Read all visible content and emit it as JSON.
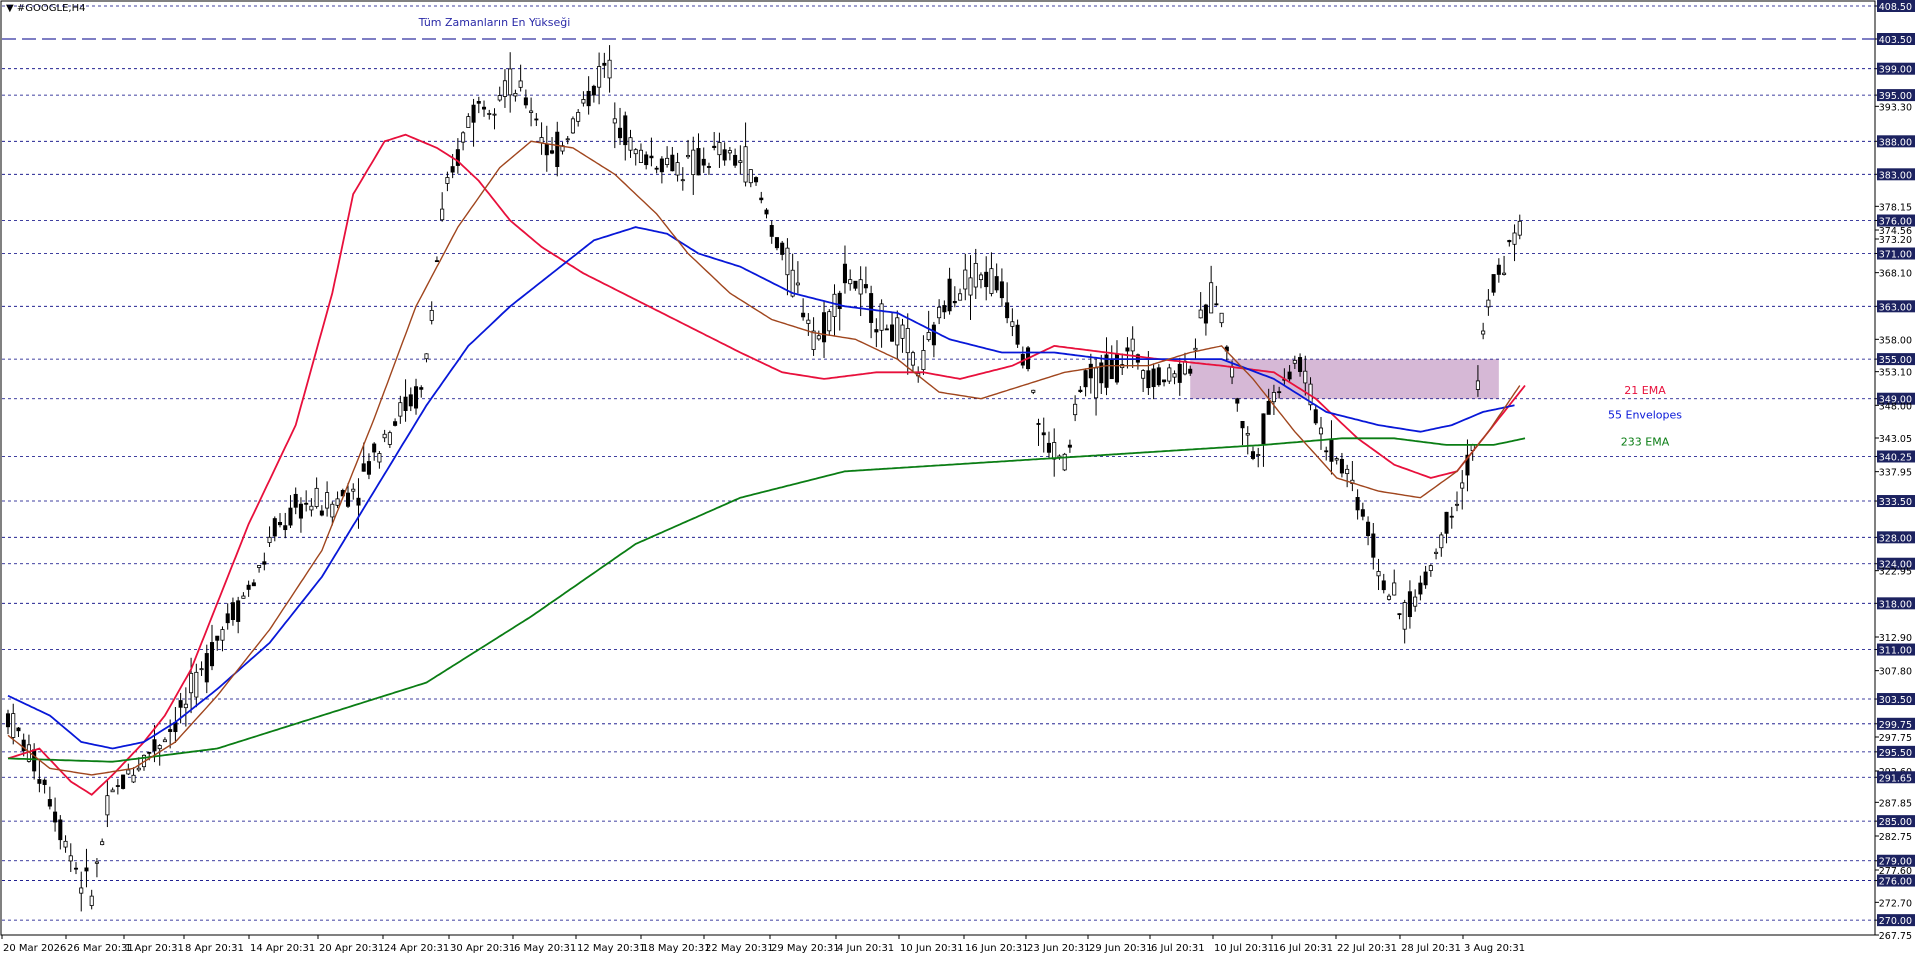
{
  "header": {
    "title": "#GOOGLE,H4"
  },
  "colors": {
    "background": "#ffffff",
    "grid": "#000080",
    "ema21": "#e8103c",
    "envelopes55": "#0818d8",
    "ema233": "#0a7d14",
    "ema_brown": "#a0461e",
    "zone": "#c8a0c8",
    "ath_line": "#3030a0",
    "axis_badge": "#1c2260"
  },
  "chart_data": {
    "type": "candlestick",
    "symbol": "#GOOGLE",
    "timeframe": "H4",
    "ylim": [
      267.75,
      408.5
    ],
    "horizontal_levels": [
      408.5,
      403.5,
      399.0,
      395.0,
      388.0,
      383.0,
      376.0,
      371.0,
      363.0,
      355.0,
      349.0,
      340.25,
      333.5,
      328.0,
      324.0,
      318.0,
      311.0,
      303.5,
      299.75,
      295.5,
      291.65,
      285.0,
      279.0,
      276.0,
      270.0
    ],
    "y_tick_labels": [
      "408.50",
      "403.50",
      "399.00",
      "395.00",
      "393.30",
      "388.00",
      "383.00",
      "378.15",
      "376.00",
      "374.56",
      "373.20",
      "371.00",
      "368.10",
      "363.00",
      "358.00",
      "355.00",
      "353.10",
      "349.00",
      "348.00",
      "343.05",
      "340.25",
      "337.95",
      "333.50",
      "328.00",
      "324.00",
      "322.95",
      "318.00",
      "312.90",
      "311.00",
      "307.80",
      "303.50",
      "299.75",
      "297.75",
      "295.50",
      "292.60",
      "291.65",
      "287.85",
      "285.00",
      "282.75",
      "279.00",
      "277.60",
      "276.00",
      "272.70",
      "270.00",
      "267.75"
    ],
    "x_tick_labels": [
      "20 Mar 2026",
      "26 Mar 20:31",
      "1 Apr 20:31",
      "8 Apr 20:31",
      "14 Apr 20:31",
      "20 Apr 20:31",
      "24 Apr 20:31",
      "30 Apr 20:31",
      "6 May 20:31",
      "12 May 20:31",
      "18 May 20:31",
      "22 May 20:31",
      "29 May 20:31",
      "4 Jun 20:31",
      "10 Jun 20:31",
      "16 Jun 20:31",
      "23 Jun 20:31",
      "29 Jun 20:31",
      "6 Jul 20:31",
      "10 Jul 20:31",
      "16 Jul 20:31",
      "22 Jul 20:31",
      "28 Jul 20:31",
      "3 Aug 20:31"
    ],
    "annotations": {
      "ath_label": "Tüm Zamanların En Yükseği",
      "ath_level": 403.5
    },
    "zone": {
      "from": 349.0,
      "to": 355.0
    },
    "legend": [
      "21 EMA",
      "55 Envelopes",
      "233 EMA"
    ],
    "series": [
      {
        "name": "21 EMA",
        "anchors": [
          [
            0,
            294.5
          ],
          [
            6,
            296
          ],
          [
            12,
            291
          ],
          [
            16,
            289
          ],
          [
            20,
            292
          ],
          [
            26,
            297
          ],
          [
            30,
            301
          ],
          [
            35,
            308
          ],
          [
            40,
            318
          ],
          [
            46,
            330
          ],
          [
            55,
            345
          ],
          [
            62,
            365
          ],
          [
            66,
            380
          ],
          [
            72,
            388
          ],
          [
            76,
            389
          ],
          [
            82,
            387
          ],
          [
            86,
            385
          ],
          [
            90,
            382
          ],
          [
            96,
            376
          ],
          [
            102,
            372
          ],
          [
            110,
            368
          ],
          [
            120,
            364
          ],
          [
            130,
            360
          ],
          [
            140,
            356
          ],
          [
            148,
            353
          ],
          [
            156,
            352
          ],
          [
            166,
            353
          ],
          [
            175,
            353
          ],
          [
            182,
            352
          ],
          [
            192,
            354
          ],
          [
            200,
            357
          ],
          [
            210,
            356
          ],
          [
            220,
            355
          ],
          [
            232,
            354
          ],
          [
            242,
            353
          ],
          [
            250,
            349
          ],
          [
            258,
            343
          ],
          [
            265,
            339
          ],
          [
            272,
            337
          ],
          [
            277,
            338
          ],
          [
            282,
            343
          ],
          [
            287,
            348
          ],
          [
            290,
            351
          ]
        ]
      },
      {
        "name": "55 Envelopes",
        "anchors": [
          [
            0,
            304
          ],
          [
            8,
            301
          ],
          [
            14,
            297
          ],
          [
            20,
            296
          ],
          [
            26,
            297
          ],
          [
            32,
            300
          ],
          [
            40,
            305
          ],
          [
            50,
            312
          ],
          [
            60,
            322
          ],
          [
            70,
            335
          ],
          [
            80,
            348
          ],
          [
            88,
            357
          ],
          [
            96,
            363
          ],
          [
            104,
            368
          ],
          [
            112,
            373
          ],
          [
            120,
            375
          ],
          [
            126,
            374
          ],
          [
            132,
            371
          ],
          [
            140,
            369
          ],
          [
            150,
            365
          ],
          [
            160,
            363
          ],
          [
            170,
            362
          ],
          [
            180,
            358
          ],
          [
            190,
            356
          ],
          [
            200,
            356
          ],
          [
            210,
            355
          ],
          [
            220,
            355
          ],
          [
            232,
            355
          ],
          [
            242,
            352
          ],
          [
            252,
            347
          ],
          [
            262,
            345
          ],
          [
            270,
            344
          ],
          [
            276,
            345
          ],
          [
            282,
            347
          ],
          [
            288,
            348
          ]
        ]
      },
      {
        "name": "233 EMA",
        "anchors": [
          [
            0,
            294.5
          ],
          [
            20,
            294
          ],
          [
            40,
            296
          ],
          [
            60,
            301
          ],
          [
            80,
            306
          ],
          [
            100,
            316
          ],
          [
            120,
            327
          ],
          [
            140,
            334
          ],
          [
            160,
            338
          ],
          [
            180,
            339
          ],
          [
            200,
            340
          ],
          [
            220,
            341
          ],
          [
            240,
            342
          ],
          [
            255,
            343
          ],
          [
            265,
            343
          ],
          [
            275,
            342
          ],
          [
            284,
            342
          ],
          [
            290,
            343
          ]
        ]
      },
      {
        "name": "brown",
        "anchors": [
          [
            0,
            298
          ],
          [
            8,
            293
          ],
          [
            16,
            292
          ],
          [
            24,
            293
          ],
          [
            32,
            297
          ],
          [
            40,
            304
          ],
          [
            50,
            314
          ],
          [
            60,
            326
          ],
          [
            70,
            346
          ],
          [
            78,
            363
          ],
          [
            86,
            375
          ],
          [
            94,
            384
          ],
          [
            100,
            388
          ],
          [
            108,
            387
          ],
          [
            116,
            383
          ],
          [
            124,
            377
          ],
          [
            130,
            371
          ],
          [
            138,
            365
          ],
          [
            146,
            361
          ],
          [
            154,
            359
          ],
          [
            162,
            358
          ],
          [
            170,
            355
          ],
          [
            178,
            350
          ],
          [
            186,
            349
          ],
          [
            194,
            351
          ],
          [
            202,
            353
          ],
          [
            210,
            354
          ],
          [
            218,
            354
          ],
          [
            226,
            356
          ],
          [
            232,
            357
          ],
          [
            238,
            352
          ],
          [
            246,
            344
          ],
          [
            254,
            337
          ],
          [
            262,
            335
          ],
          [
            270,
            334
          ],
          [
            277,
            338
          ],
          [
            283,
            344
          ],
          [
            289,
            351
          ]
        ]
      }
    ]
  }
}
